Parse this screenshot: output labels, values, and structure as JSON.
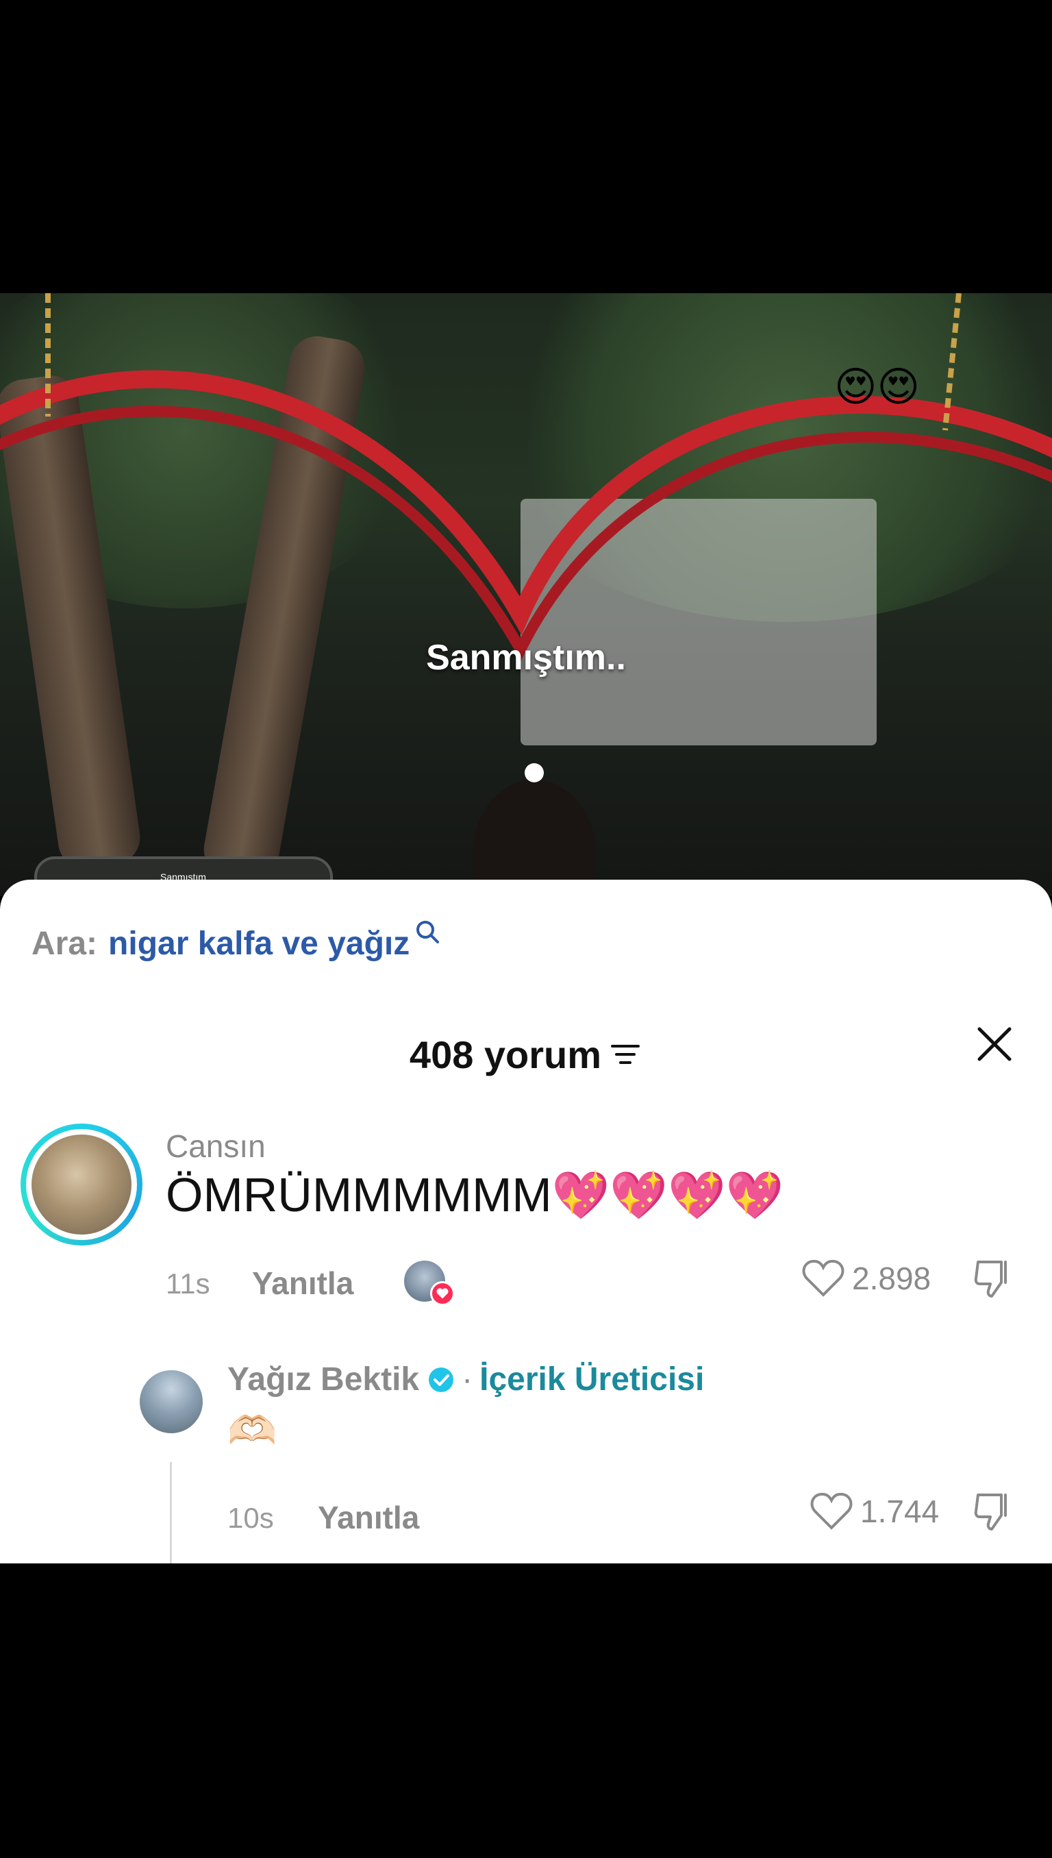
{
  "video": {
    "caption": "Sanmıştım..",
    "emoji": "😍😍",
    "mini_thumb_label": "Sanmıştım"
  },
  "search_suggestion": {
    "prefix": "Ara:",
    "term": "nigar kalfa ve yağız"
  },
  "comments_header": {
    "count_label": "408 yorum"
  },
  "comment": {
    "author": "Cansın",
    "text": "ÖMRÜMMMMMM",
    "emoji": "💖💖💖💖",
    "time": "11s",
    "reply_label": "Yanıtla",
    "likes": "2.898"
  },
  "reply": {
    "author": "Yağız Bektik",
    "separator": "·",
    "role": "İçerik Üreticisi",
    "text": "🫶🏻",
    "time": "10s",
    "reply_label": "Yanıtla",
    "likes": "1.744"
  },
  "colors": {
    "accent_link": "#2c5aa8",
    "creator_role": "#1a8a9c",
    "story_ring": "#22d0e8",
    "like_badge": "#fe2c55"
  }
}
